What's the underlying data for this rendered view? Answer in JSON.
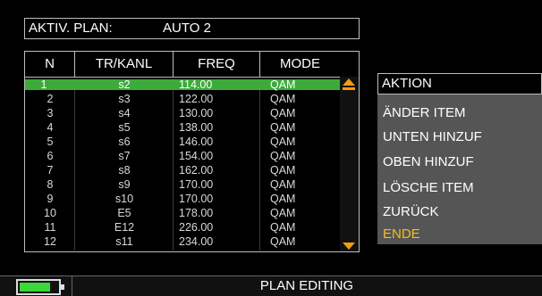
{
  "active_plan": {
    "label": "AKTIV. PLAN:",
    "value": "AUTO 2"
  },
  "table": {
    "headers": [
      "N",
      "TR/KANL",
      "FREQ",
      "MODE"
    ],
    "rows": [
      {
        "n": "1",
        "kanl": "s2",
        "freq": "114.00",
        "mode": "QAM"
      },
      {
        "n": "2",
        "kanl": "s3",
        "freq": "122.00",
        "mode": "QAM"
      },
      {
        "n": "3",
        "kanl": "s4",
        "freq": "130.00",
        "mode": "QAM"
      },
      {
        "n": "4",
        "kanl": "s5",
        "freq": "138.00",
        "mode": "QAM"
      },
      {
        "n": "5",
        "kanl": "s6",
        "freq": "146.00",
        "mode": "QAM"
      },
      {
        "n": "6",
        "kanl": "s7",
        "freq": "154.00",
        "mode": "QAM"
      },
      {
        "n": "7",
        "kanl": "s8",
        "freq": "162.00",
        "mode": "QAM"
      },
      {
        "n": "8",
        "kanl": "s9",
        "freq": "170.00",
        "mode": "QAM"
      },
      {
        "n": "9",
        "kanl": "s10",
        "freq": "170.00",
        "mode": "QAM"
      },
      {
        "n": "10",
        "kanl": "E5",
        "freq": "178.00",
        "mode": "QAM"
      },
      {
        "n": "11",
        "kanl": "E12",
        "freq": "226.00",
        "mode": "QAM"
      },
      {
        "n": "12",
        "kanl": "s11",
        "freq": "234.00",
        "mode": "QAM"
      }
    ],
    "selected_row": 0
  },
  "action_menu": {
    "title": "AKTION",
    "items": [
      "ÄNDER ITEM",
      "UNTEN HINZUF",
      "OBEN HINZUF",
      "LÖSCHE ITEM",
      "ZURÜCK",
      "ENDE"
    ],
    "highlighted_item": "ENDE"
  },
  "status_bar": {
    "text": "PLAN EDITING"
  },
  "battery_level": 0.8,
  "colors": {
    "selection": "#3cab3a",
    "accent": "#f39c12",
    "highlight": "#f0c020",
    "battery": "#3ad63a"
  }
}
